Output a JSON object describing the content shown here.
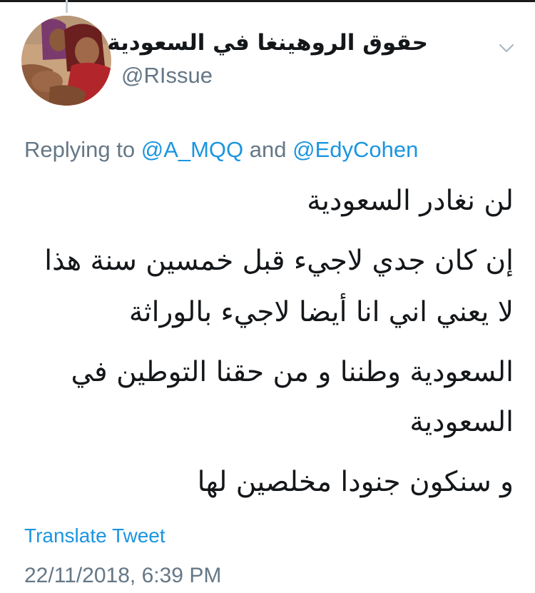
{
  "tweet": {
    "author": {
      "display_name": "حقوق الروهينغا في السعودية",
      "handle": "@RIssue",
      "avatar_icon": "profile-photo",
      "menu_icon": "chevron-down-icon"
    },
    "reply": {
      "prefix": "Replying to",
      "mention_1": "@A_MQQ",
      "joiner": "and",
      "mention_2": "@EdyCohen"
    },
    "body_lines": [
      "لن نغادر السعودية",
      "إن كان جدي لاجيء قبل خمسين سنة هذا",
      "لا يعني اني انا أيضا لاجيء بالوراثة",
      "السعودية وطننا و من حقنا التوطين في",
      "السعودية",
      "و سنكون جنودا مخلصين لها"
    ],
    "translate_label": "Translate Tweet",
    "timestamp": "22/11/2018, 6:39 PM"
  },
  "colors": {
    "text": "#14171a",
    "secondary": "#657786",
    "link": "#1b95e0",
    "background": "#ffffff"
  }
}
